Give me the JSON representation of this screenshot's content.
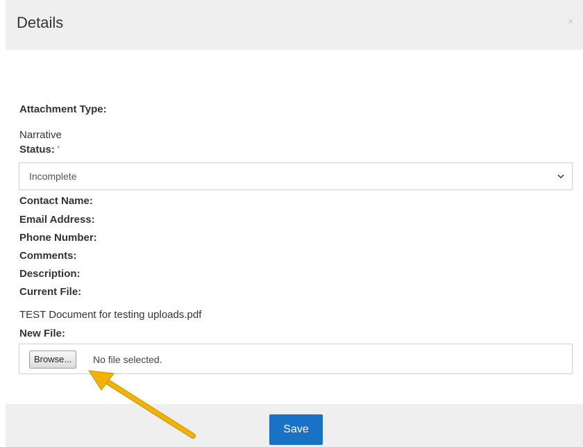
{
  "dialog": {
    "title": "Details",
    "close_glyph": "×"
  },
  "fields": {
    "attachment_type_label": "Attachment Type:",
    "attachment_type_value": "Narrative",
    "status_label": "Status:",
    "status_required_mark": "*",
    "status_value": "Incomplete",
    "contact_name_label": "Contact Name:",
    "email_address_label": "Email Address:",
    "phone_number_label": "Phone Number:",
    "comments_label": "Comments:",
    "description_label": "Description:",
    "current_file_label": "Current File:",
    "current_file_value": "TEST Document for testing uploads.pdf",
    "new_file_label": "New File:",
    "browse_label": "Browse...",
    "no_file_text": "No file selected."
  },
  "footer": {
    "save_label": "Save"
  },
  "colors": {
    "header_bg": "#efefef",
    "save_button": "#1a72c6",
    "annotation_arrow": "#f0b400"
  },
  "icons": {
    "close": "close-icon",
    "select_caret": "chevron-down-icon",
    "annotation": "arrow-annotation"
  }
}
